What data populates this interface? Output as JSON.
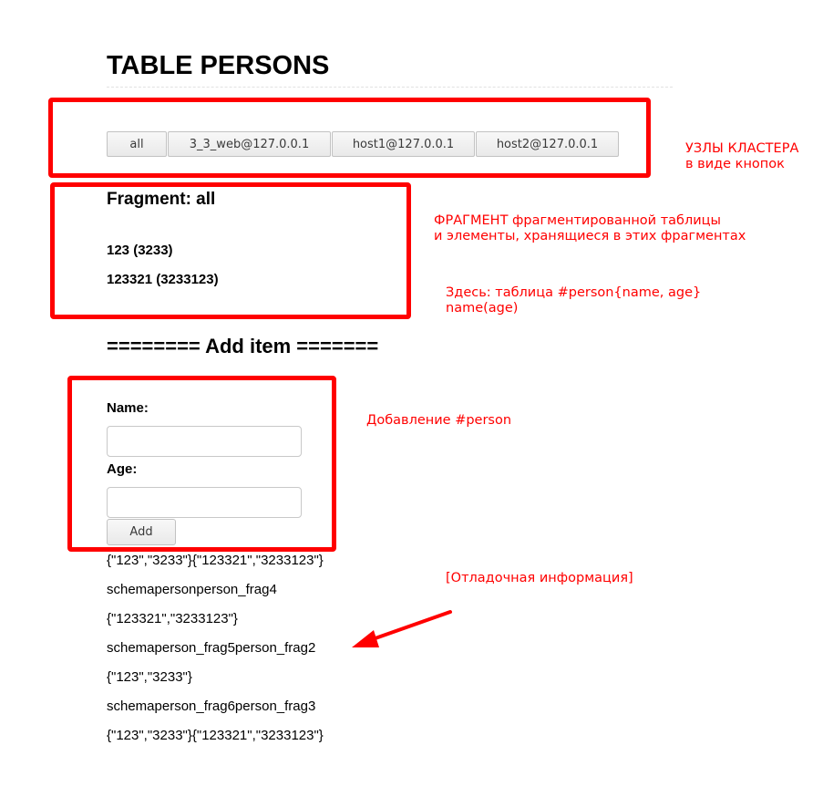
{
  "page_title": "TABLE PERSONS",
  "node_buttons": [
    "all",
    "3_3_web@127.0.0.1",
    "host1@127.0.0.1",
    "host2@127.0.0.1"
  ],
  "fragment": {
    "title": "Fragment: all",
    "items": [
      "123 (3233)",
      "123321 (3233123)"
    ]
  },
  "add_form": {
    "title": "======== Add item =======",
    "name_label": "Name:",
    "name_value": "",
    "age_label": "Age:",
    "age_value": "",
    "submit_label": "Add"
  },
  "debug_lines": [
    "{\"123\",\"3233\"}{\"123321\",\"3233123\"}",
    "schemapersonperson_frag4",
    "{\"123321\",\"3233123\"}",
    "schemaperson_frag5person_frag2",
    "{\"123\",\"3233\"}",
    "schemaperson_frag6person_frag3",
    "{\"123\",\"3233\"}{\"123321\",\"3233123\"}"
  ],
  "annotations": {
    "cluster_nodes": [
      "УЗЛЫ КЛАСТЕРА",
      "в виде кнопок"
    ],
    "fragment": [
      "ФРАГМЕНТ фрагментированной таблицы",
      "и элементы, хранящиеся в этих фрагментах"
    ],
    "table": [
      "Здесь: таблица #person{name, age}",
      "name(age)"
    ],
    "add_person": "Добавление #person",
    "debug_info": "[Отладочная информация]"
  },
  "colors": {
    "annotation": "#ff0000",
    "button_border": "#c2c2c2",
    "input_border": "#c8c8c8"
  }
}
